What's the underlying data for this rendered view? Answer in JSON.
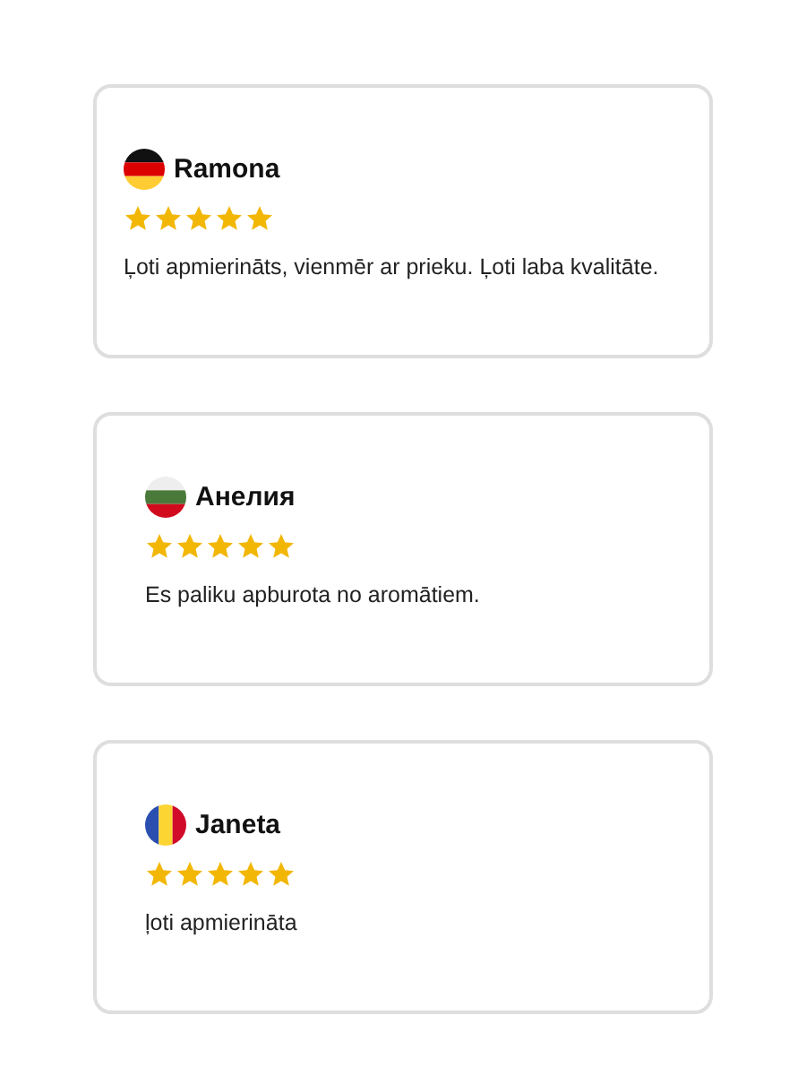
{
  "reviews": [
    {
      "kind": "germany",
      "name": "Ramona",
      "stars": 5,
      "text": "Ļoti apmierināts, vienmēr ar prieku. Ļoti laba kvalitāte."
    },
    {
      "kind": "bulgaria",
      "name": "Анелия",
      "stars": 5,
      "text": "Es paliku apburota no aromātiem."
    },
    {
      "kind": "romania",
      "name": "Janeta",
      "stars": 5,
      "text": "ļoti apmierināta"
    }
  ]
}
